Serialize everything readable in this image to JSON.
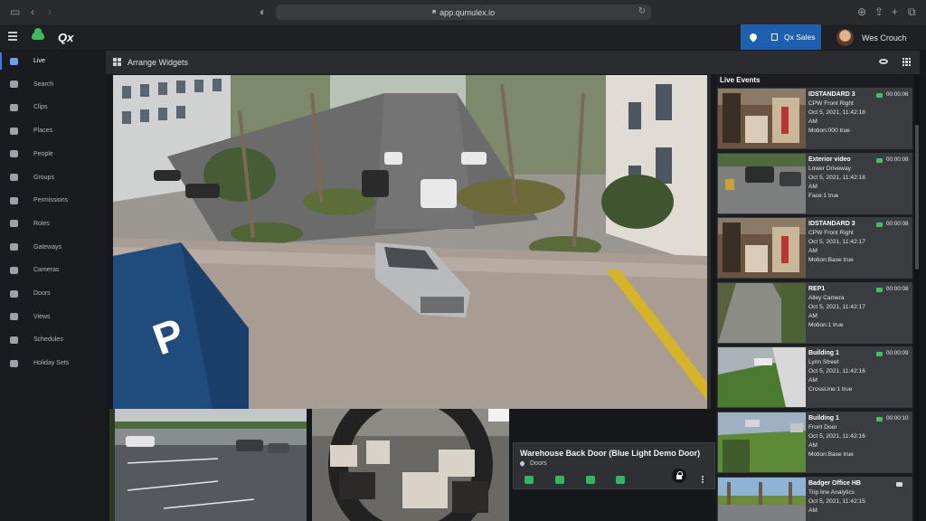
{
  "browser": {
    "url": "app.qumulex.io"
  },
  "header": {
    "logo": "Qx",
    "site_button": "Qx Sales",
    "user_name": "Wes Crouch"
  },
  "sidebar": {
    "items": [
      {
        "label": "Live",
        "icon": "monitor-icon",
        "active": true
      },
      {
        "label": "Search",
        "icon": "search-icon"
      },
      {
        "label": "Clips",
        "icon": "clip-icon"
      },
      {
        "label": "Places",
        "icon": "map-pin-icon"
      },
      {
        "label": "People",
        "icon": "person-icon"
      },
      {
        "label": "Groups",
        "icon": "group-icon"
      },
      {
        "label": "Permissions",
        "icon": "key-icon"
      },
      {
        "label": "Roles",
        "icon": "role-icon"
      },
      {
        "label": "Gateways",
        "icon": "gateway-icon"
      },
      {
        "label": "Cameras",
        "icon": "camera-icon"
      },
      {
        "label": "Doors",
        "icon": "door-icon"
      },
      {
        "label": "Views",
        "icon": "eye-icon"
      },
      {
        "label": "Schedules",
        "icon": "calendar-icon"
      },
      {
        "label": "Holiday Sets",
        "icon": "holiday-icon"
      }
    ]
  },
  "toolbar": {
    "title": "Arrange Widgets"
  },
  "door_widget": {
    "title": "Warehouse Back Door (Blue Light Demo Door)",
    "subtitle": "Doors"
  },
  "events": {
    "title": "Live Events",
    "items": [
      {
        "name": "IDSTANDARD 3",
        "camera": "CPW Front Right",
        "date": "Oct 5, 2021, 11:42:18",
        "ampm": "AM",
        "detail": "Motion:000 true",
        "duration": "00:00:06",
        "thumb": "store"
      },
      {
        "name": "Exterior video",
        "camera": "Lower Driveway",
        "date": "Oct 5, 2021, 11:42:18",
        "ampm": "AM",
        "detail": "Face:1 true",
        "duration": "00:00:08",
        "thumb": "drive"
      },
      {
        "name": "IDSTANDARD 3",
        "camera": "CPW Front Right",
        "date": "Oct 5, 2021, 11:42:17",
        "ampm": "AM",
        "detail": "Motion:Base true",
        "duration": "00:00:08",
        "thumb": "store"
      },
      {
        "name": "REP1",
        "camera": "Alley Camera",
        "date": "Oct 5, 2021, 11:42:17",
        "ampm": "AM",
        "detail": "Motion:1 true",
        "duration": "00:00:08",
        "thumb": "alley"
      },
      {
        "name": "Building 1",
        "camera": "Lynn Street",
        "date": "Oct 5, 2021, 11:42:16",
        "ampm": "AM",
        "detail": "CrossLine:1 true",
        "duration": "00:00:09",
        "thumb": "lawn"
      },
      {
        "name": "Building 1",
        "camera": "Front Door",
        "date": "Oct 5, 2021, 11:42:16",
        "ampm": "AM",
        "detail": "Motion:Base true",
        "duration": "00:00:10",
        "thumb": "front"
      },
      {
        "name": "Badger Office HB",
        "camera": "Trip line Analytics",
        "date": "Oct 5, 2021, 11:42:15",
        "ampm": "AM",
        "detail": "",
        "duration": "",
        "thumb": "badger"
      }
    ]
  }
}
